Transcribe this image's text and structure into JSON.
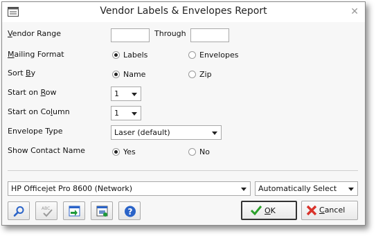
{
  "window": {
    "title": "Vendor Labels & Envelopes Report"
  },
  "fields": {
    "vendor_range": {
      "label_pre": "",
      "label_key": "V",
      "label_post": "endor Range",
      "from_value": "",
      "through_label": "Through",
      "to_value": ""
    },
    "mailing_format": {
      "label_key": "M",
      "label_post": "ailing Format",
      "options": [
        "Labels",
        "Envelopes"
      ],
      "selected": "Labels"
    },
    "sort_by": {
      "label_pre": "Sort ",
      "label_key": "B",
      "label_post": "y",
      "options": [
        "Name",
        "Zip"
      ],
      "selected": "Name"
    },
    "start_on_row": {
      "label_pre": "Start on ",
      "label_key": "R",
      "label_post": "ow",
      "value": "1"
    },
    "start_on_column": {
      "label_pre": "Start on Co",
      "label_key": "l",
      "label_post": "umn",
      "value": "1"
    },
    "envelope_type": {
      "label": "Envelope Type",
      "value": "Laser (default)"
    },
    "show_contact_name": {
      "label": "Show Contact Name",
      "options": [
        "Yes",
        "No"
      ],
      "selected": "Yes"
    }
  },
  "printer": {
    "name": "HP Officejet Pro 8600 (Network)",
    "tray": "Automatically Select"
  },
  "buttons": {
    "ok_pre": "",
    "ok_key": "O",
    "ok_post": "K",
    "cancel_key": "C",
    "cancel_post": "ancel"
  },
  "colors": {
    "ok_check": "#2aa02a",
    "cancel_x": "#d9322a",
    "help": "#2a63c8"
  }
}
